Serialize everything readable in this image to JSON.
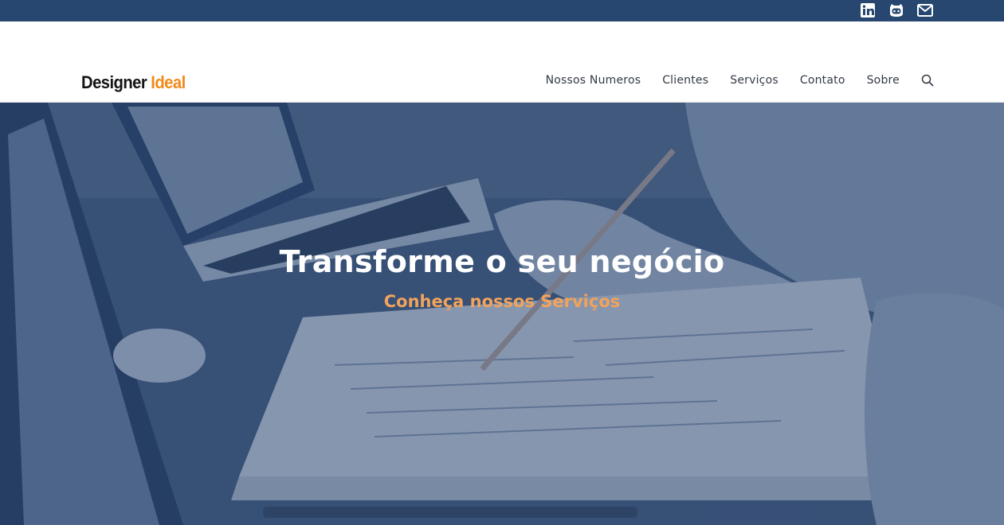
{
  "topbar": {
    "social": [
      {
        "name": "linkedin-icon"
      },
      {
        "name": "github-icon"
      },
      {
        "name": "mail-icon"
      }
    ]
  },
  "header": {
    "logo": {
      "word1": "Designer",
      "word2": "Ideal"
    },
    "nav": [
      {
        "label": "Nossos Numeros"
      },
      {
        "label": "Clientes"
      },
      {
        "label": "Serviços"
      },
      {
        "label": "Contato"
      },
      {
        "label": "Sobre"
      }
    ],
    "search_icon": "search-icon"
  },
  "hero": {
    "title": "Transforme o seu negócio",
    "subtitle": "Conheça nossos Serviços"
  },
  "colors": {
    "topbar": "#274770",
    "accent": "#f08a1c",
    "hero_overlay": "#223e69",
    "subtitle": "#f1a35c"
  }
}
